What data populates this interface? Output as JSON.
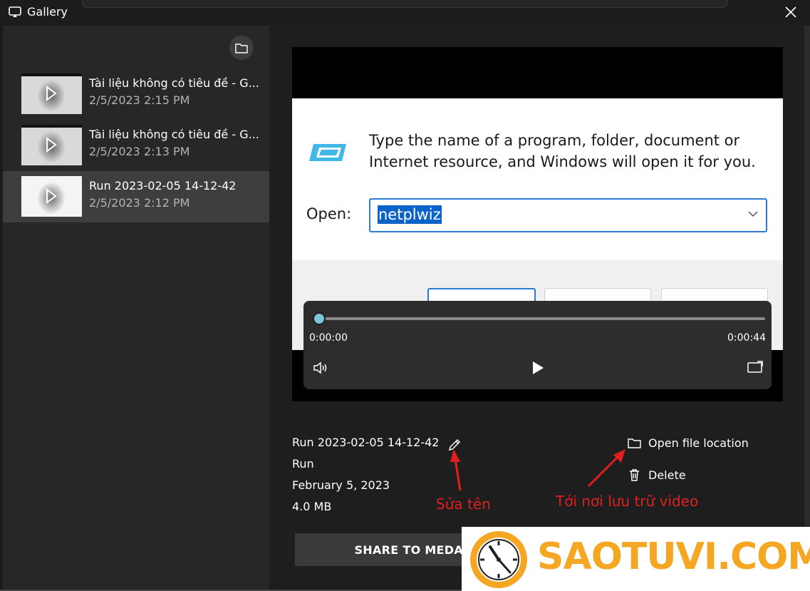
{
  "window": {
    "title": "Gallery"
  },
  "gallery": {
    "items": [
      {
        "title": "Tài liệu không có tiêu đề - G...",
        "date": "2/5/2023 2:15 PM",
        "selected": false
      },
      {
        "title": "Tài liệu không có tiêu đề - G...",
        "date": "2/5/2023 2:13 PM",
        "selected": false
      },
      {
        "title": "Run 2023-02-05 14-12-42",
        "date": "2/5/2023 2:12 PM",
        "selected": true
      }
    ]
  },
  "video": {
    "dialog_message_line1": "Type the name of a program, folder, document or",
    "dialog_message_line2": "Internet resource, and Windows will open it for you.",
    "open_label": "Open:",
    "open_value": "netplwiz",
    "current_time": "0:00:00",
    "total_time": "0:00:44",
    "progress": 0
  },
  "details": {
    "name": "Run 2023-02-05 14-12-42",
    "app": "Run",
    "date": "February 5, 2023",
    "size": "4.0 MB"
  },
  "actions": {
    "open_location": "Open file location",
    "delete": "Delete",
    "share": "SHARE TO MEDAL"
  },
  "annotations": {
    "rename": "Sửa tên",
    "location": "Tới nơi lưu trữ video"
  },
  "watermark": {
    "text": "SAOTUVI.COM"
  },
  "colors": {
    "accent": "#0b63c9",
    "annotation": "#e02020",
    "brand": "#f5a623"
  }
}
